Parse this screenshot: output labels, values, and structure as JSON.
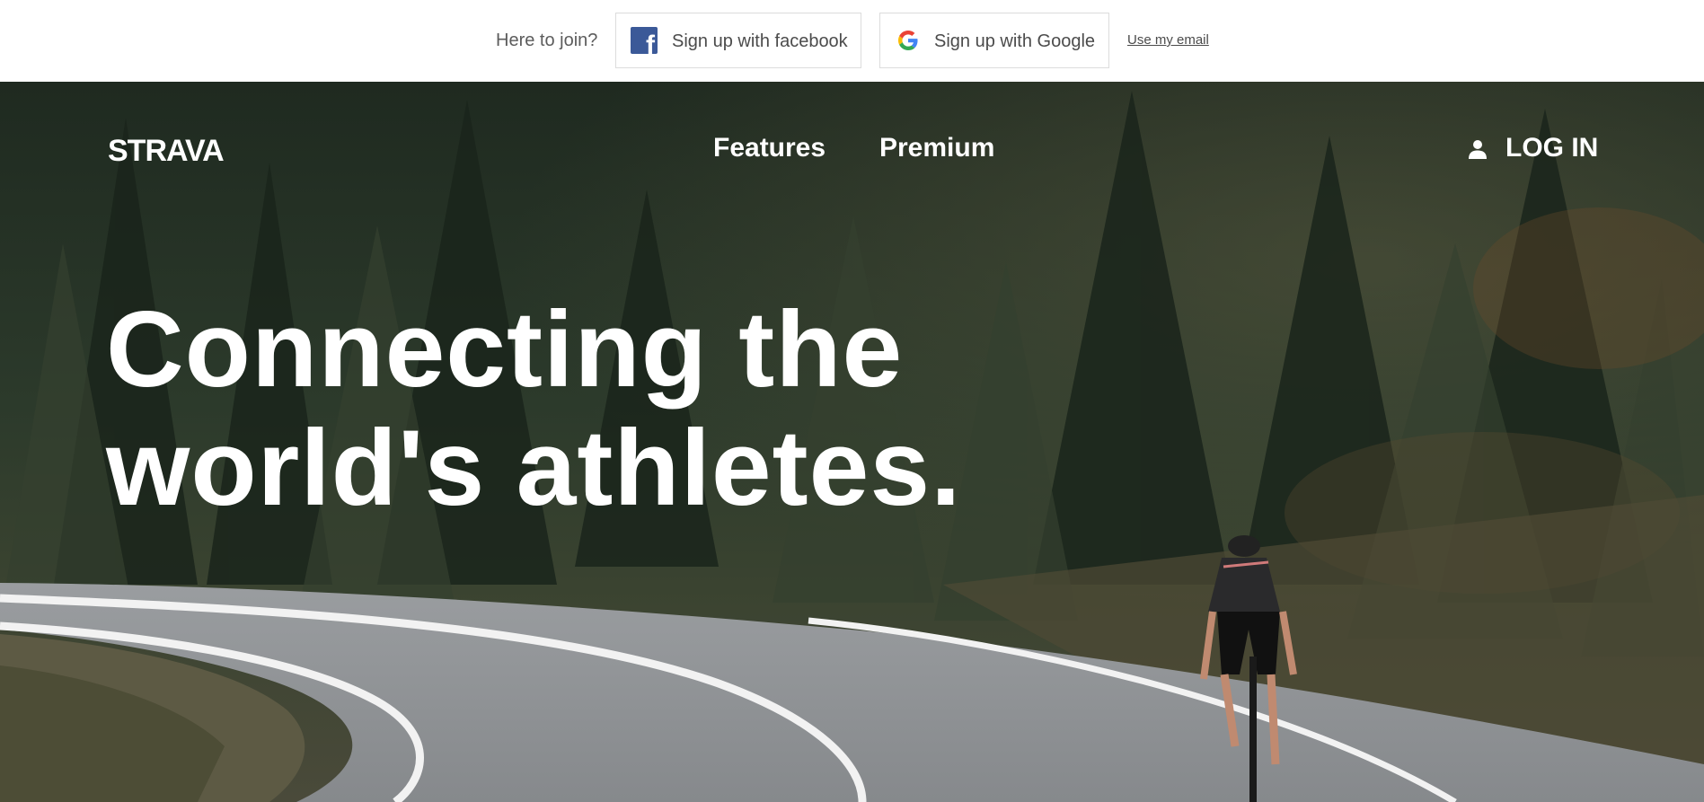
{
  "join_bar": {
    "prompt": "Here to join?",
    "facebook_label": "Sign up with facebook",
    "google_label": "Sign up with Google",
    "email_label": "Use my email"
  },
  "nav": {
    "logo": "STRAVA",
    "features": "Features",
    "premium": "Premium",
    "login": "LOG IN"
  },
  "hero": {
    "headline_line1": "Connecting the",
    "headline_line2": "world's athletes."
  },
  "icons": {
    "facebook": "facebook-icon",
    "google": "google-icon",
    "login": "user-icon"
  },
  "colors": {
    "facebook_blue": "#3b5998",
    "hero_text": "#ffffff",
    "join_text": "#5c5c5c"
  }
}
